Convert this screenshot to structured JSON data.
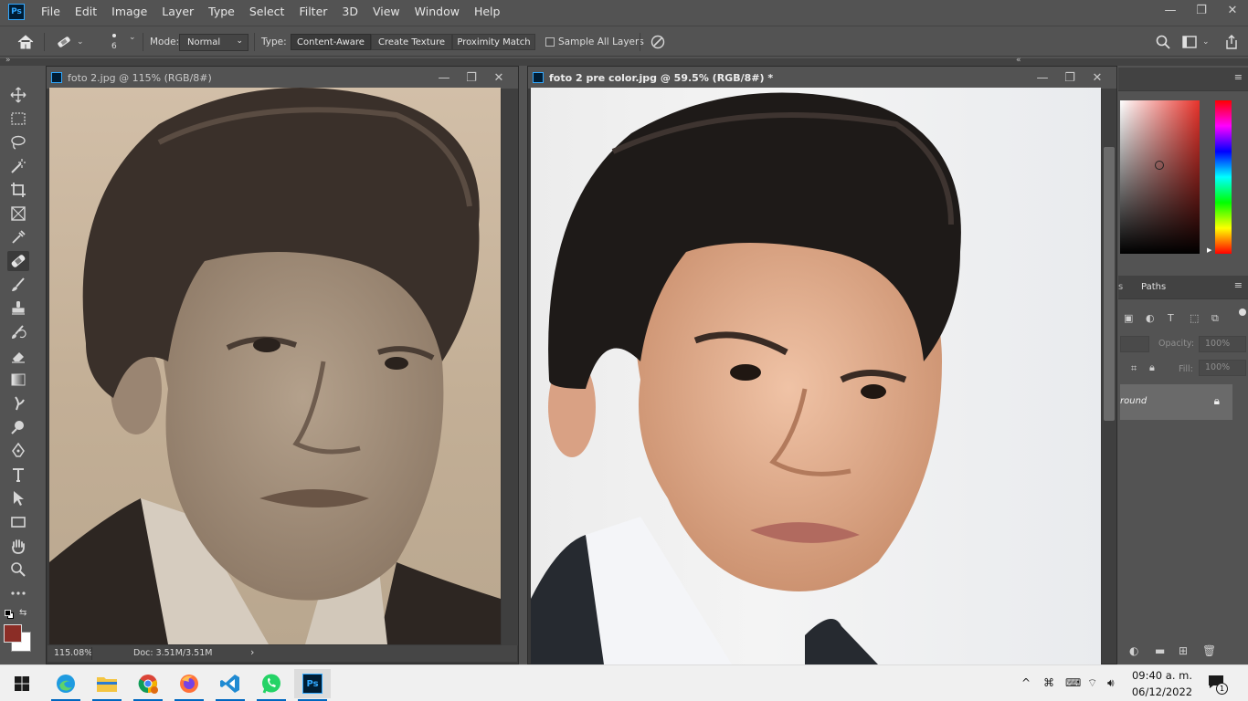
{
  "app": {
    "logo_text": "Ps"
  },
  "menu": [
    "File",
    "Edit",
    "Image",
    "Layer",
    "Type",
    "Select",
    "Filter",
    "3D",
    "View",
    "Window",
    "Help"
  ],
  "window_controls": {
    "minimize": "—",
    "restore": "❐",
    "close": "✕"
  },
  "options": {
    "brush_size": "6",
    "mode_label": "Mode:",
    "mode_value": "Normal",
    "type_label": "Type:",
    "type_buttons": [
      "Content-Aware",
      "Create Texture",
      "Proximity Match"
    ],
    "type_active": "Content-Aware",
    "sample_all_layers_label": "Sample All Layers"
  },
  "documents": [
    {
      "title": "foto 2.jpg @ 115% (RGB/8#)",
      "zoom": "115.08%",
      "doc_size": "Doc: 3.51M/3.51M"
    },
    {
      "title": "foto 2 pre color.jpg @ 59.5% (RGB/8#) *"
    }
  ],
  "panels": {
    "paths_tab_partial": "s",
    "paths_tab": "Paths",
    "opacity_label": "Opacity:",
    "opacity_value": "100%",
    "fill_label": "Fill:",
    "fill_value": "100%",
    "layer_name_partial": "round"
  },
  "colors": {
    "foreground": "#8b2d26",
    "background": "#ffffff",
    "picker_hue": "#e8332b"
  },
  "taskbar": {
    "apps": [
      "windows-start",
      "edge",
      "file-explorer",
      "chrome",
      "firefox",
      "vscode",
      "whatsapp",
      "photoshop"
    ],
    "running": [
      "edge",
      "file-explorer",
      "chrome",
      "firefox",
      "vscode",
      "whatsapp",
      "photoshop"
    ],
    "time": "09:40 a. m.",
    "date": "06/12/2022",
    "notification_count": "1"
  }
}
